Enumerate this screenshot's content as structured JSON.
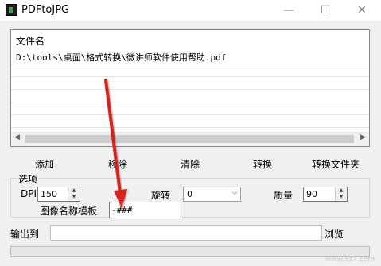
{
  "window": {
    "title": "PDFtoJPG"
  },
  "file_list": {
    "header": "文件名",
    "rows": [
      "D:\\tools\\桌面\\格式转换\\微讲师软件使用帮助.pdf"
    ]
  },
  "actions": {
    "add": "添加",
    "remove": "移除",
    "clear": "清除",
    "convert": "转换",
    "convert_folder": "转换文件夹"
  },
  "options": {
    "group_label": "选项",
    "dpi_label": "DPI",
    "dpi_value": "150",
    "rotate_label": "旋转",
    "rotate_value": "0",
    "quality_label": "质量",
    "quality_value": "90",
    "template_label": "图像名称模板",
    "template_value": "-###"
  },
  "output": {
    "label": "输出到",
    "value": "",
    "browse": "浏览"
  },
  "watermark": {
    "text": "www.xz7.com"
  },
  "colors": {
    "arrow": "#d8211c"
  }
}
